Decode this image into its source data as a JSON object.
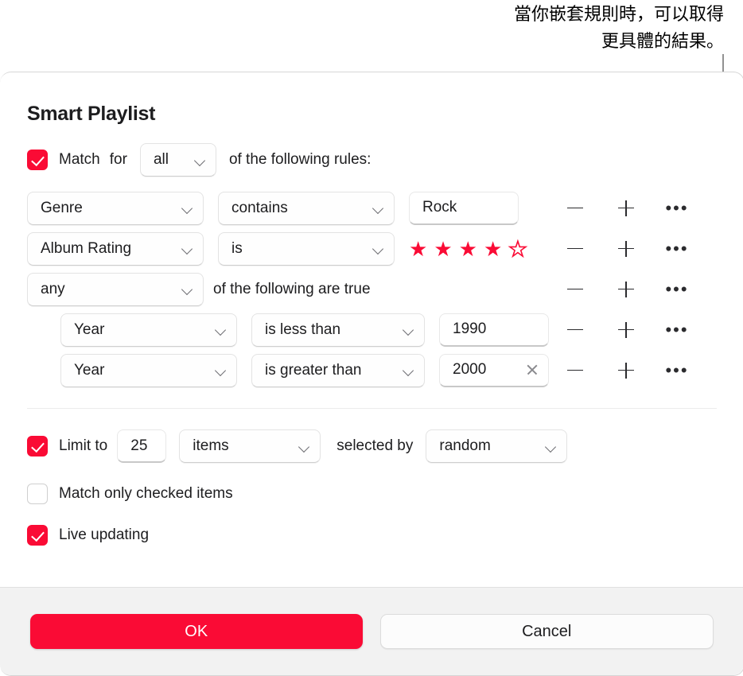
{
  "annotation": {
    "text": "當你嵌套規則時，可以取得\n更具體的結果。"
  },
  "dialog": {
    "title": "Smart Playlist",
    "match": {
      "checked": true,
      "label": "Match",
      "for_label": "for",
      "selected": "all",
      "suffix": "of the following rules:"
    },
    "rules": [
      {
        "field": "Genre",
        "operator": "contains",
        "value": "Rock",
        "remove_icon": "minus-icon",
        "add_icon": "plus-icon",
        "more_icon": "ellipsis-icon"
      },
      {
        "field": "Album Rating",
        "operator": "is",
        "stars_filled": 4,
        "stars_total": 5,
        "remove_icon": "minus-icon",
        "add_icon": "plus-icon",
        "more_icon": "ellipsis-icon"
      }
    ],
    "group": {
      "selected": "any",
      "label": "of the following are true",
      "rules": [
        {
          "field": "Year",
          "operator": "is less than",
          "value": "1990",
          "has_clear": false
        },
        {
          "field": "Year",
          "operator": "is greater than",
          "value": "2000",
          "has_clear": true,
          "clear_icon": "clear-x-icon"
        }
      ]
    },
    "limit": {
      "checked": true,
      "label": "Limit to",
      "amount": "25",
      "unit": "items",
      "selected_by_label": "selected by",
      "selected_by": "random"
    },
    "match_checked_only": {
      "checked": false,
      "label": "Match only checked items"
    },
    "live_updating": {
      "checked": true,
      "label": "Live updating"
    },
    "footer": {
      "ok": "OK",
      "cancel": "Cancel"
    }
  },
  "colors": {
    "accent": "#FA0B35",
    "footer_bg": "#F2F2F2",
    "border": "#D6D6D6"
  }
}
